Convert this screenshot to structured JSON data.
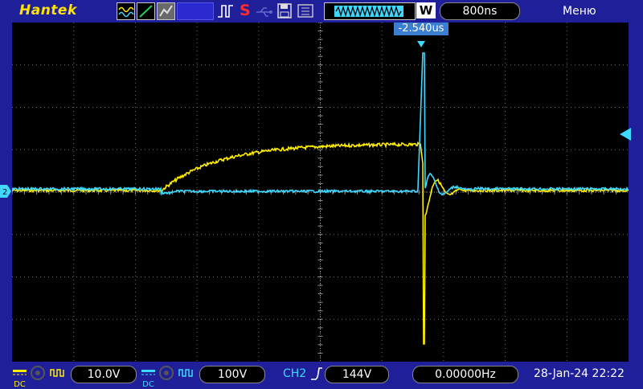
{
  "brand": "Hantek",
  "menu_label": "Меню",
  "run_status": "S",
  "timebase": "800ns",
  "timebase_letter": "W",
  "trigger_position_label": "-2.540us",
  "ch1": {
    "coupling": "DC",
    "scale": "10.0V",
    "color": "#ffee00"
  },
  "ch2": {
    "coupling": "DC",
    "scale": "100V",
    "color": "#3fd8ff"
  },
  "trigger": {
    "source": "CH2",
    "level": "144V"
  },
  "frequency": "0.00000Hz",
  "datetime": "28-Jan-24 22:22",
  "icons": [
    "acquire-mode-icon",
    "run-mode-icon",
    "persistence-icon",
    "pulse-trigger-icon",
    "save-icon",
    "usb-icon",
    "memory-depth-icon",
    "ch1-marker-icon",
    "trigger-level-marker-icon"
  ],
  "colors": {
    "background": "#1f1f9a",
    "screen": "#000000",
    "grid": "#707070",
    "accent": "#ffee00"
  }
}
